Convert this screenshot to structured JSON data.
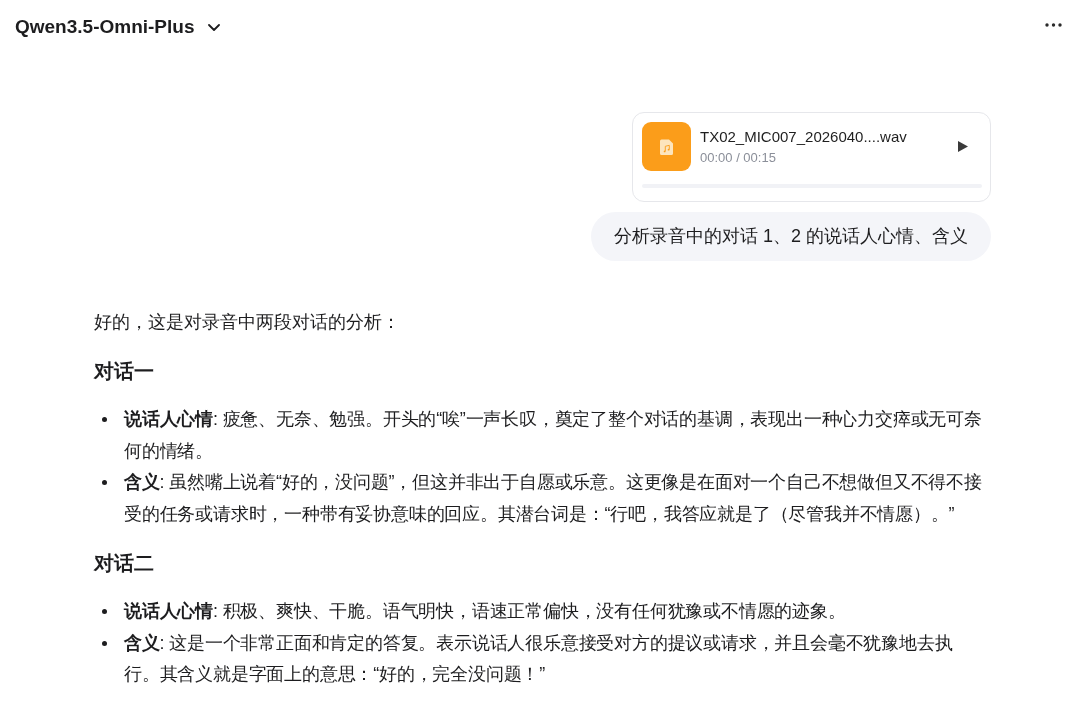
{
  "header": {
    "title": "Qwen3.5-Omni-Plus"
  },
  "user_message": {
    "attachment": {
      "file_name": "TX02_MIC007_2026040....wav",
      "time": "00:00 / 00:15"
    },
    "text": "分析录音中的对话 1、2 的说话人心情、含义"
  },
  "reply": {
    "blocks": [
      {
        "kind": "paragraph",
        "text": "好的，这是对录音中两段对话的分析："
      },
      {
        "kind": "heading",
        "text": "对话一"
      },
      {
        "kind": "list",
        "items": [
          "**说话人心情**: 疲惫、无奈、勉强。开头的“唉”一声长叹，奠定了整个对话的基调，表现出一种心力交瘁或无可奈何的情绪。",
          "**含义**: 虽然嘴上说着“好的，没问题”，但这并非出于自愿或乐意。这更像是在面对一个自己不想做但又不得不接受的任务或请求时，一种带有妥协意味的回应。其潜台词是：“行吧，我答应就是了（尽管我并不情愿）。”"
        ]
      },
      {
        "kind": "heading",
        "text": "对话二"
      },
      {
        "kind": "list",
        "items": [
          "**说话人心情**: 积极、爽快、干脆。语气明快，语速正常偏快，没有任何犹豫或不情愿的迹象。",
          "**含义**: 这是一个非常正面和肯定的答复。表示说话人很乐意接受对方的提议或请求，并且会毫不犹豫地去执行。其含义就是字面上的意思：“好的，完全没问题！”"
        ]
      }
    ]
  }
}
